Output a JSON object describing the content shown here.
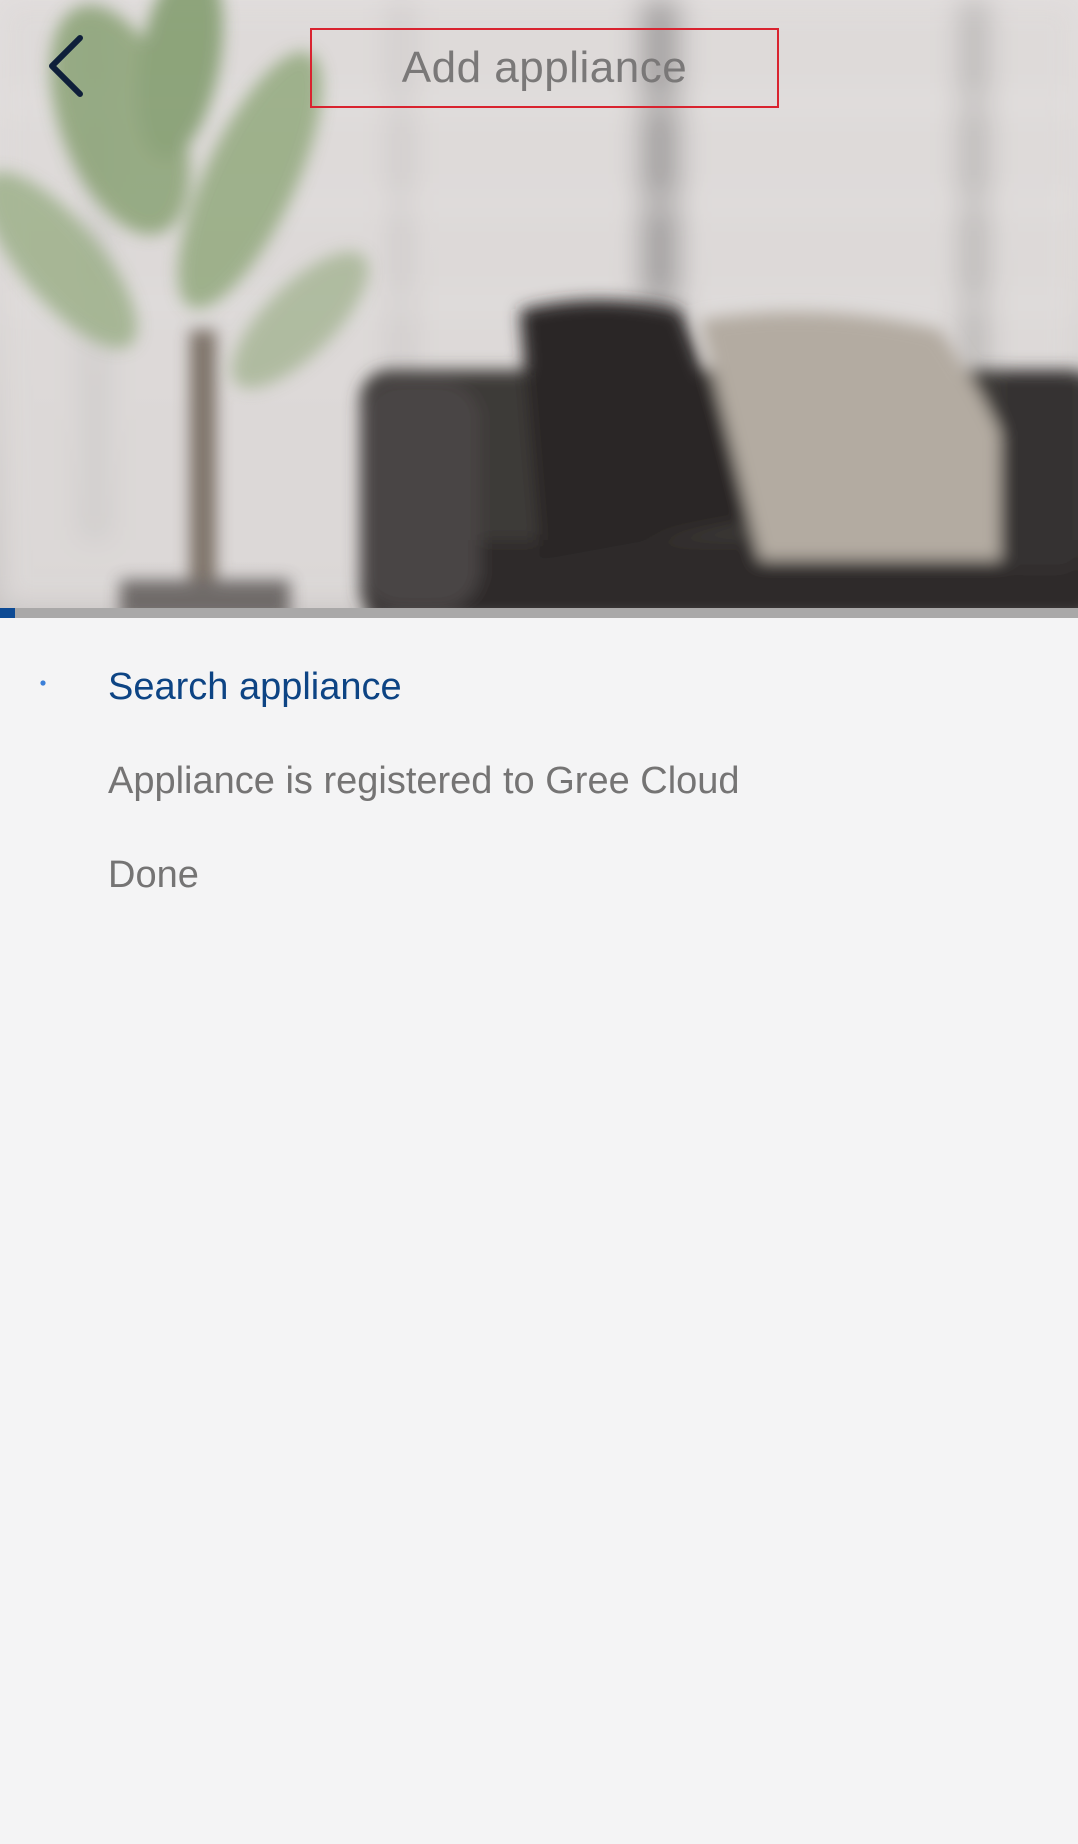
{
  "header": {
    "title": "Add appliance"
  },
  "progress": {
    "value_percent": 1.4,
    "color": "#0d4a94"
  },
  "steps": [
    {
      "label": "Search appliance",
      "state": "active"
    },
    {
      "label": "Appliance is registered to Gree Cloud",
      "state": "pending"
    },
    {
      "label": "Done",
      "state": "pending"
    }
  ],
  "colors": {
    "accent": "#0d4484",
    "title_border": "#d9232f",
    "muted_text": "#757474",
    "background": "#f4f4f5"
  },
  "icons": {
    "back": "chevron-left-icon",
    "step_indicator": "loading-spinner-icon"
  }
}
